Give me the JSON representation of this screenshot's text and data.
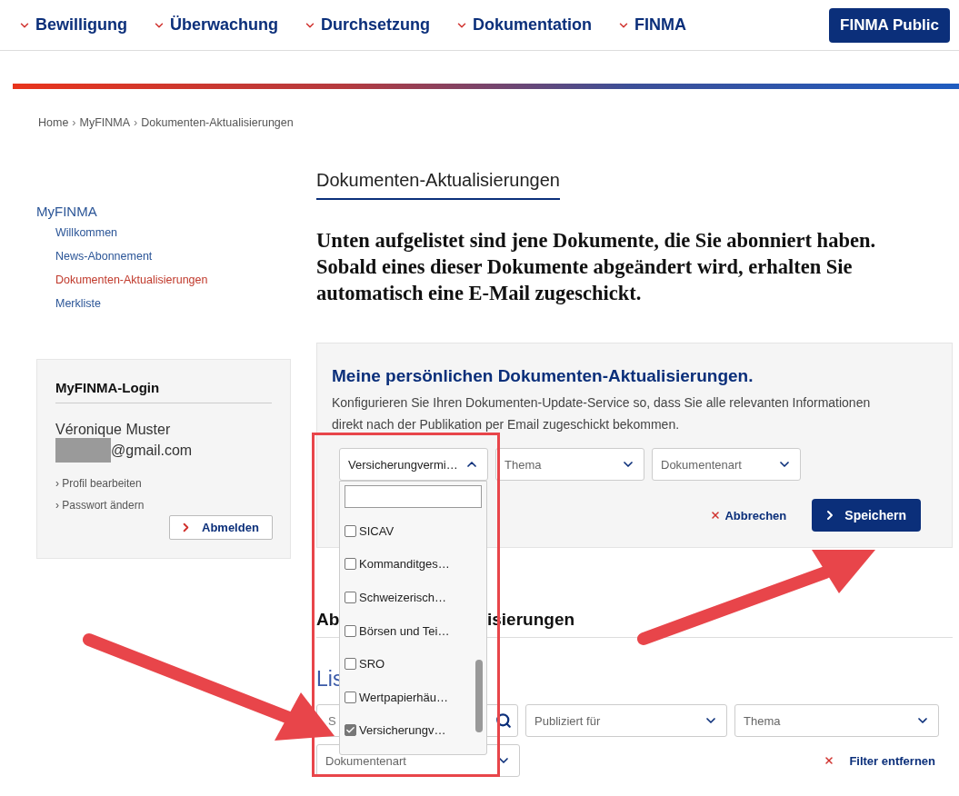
{
  "nav": {
    "items": [
      {
        "label": "Bewilligung"
      },
      {
        "label": "Überwachung"
      },
      {
        "label": "Durchsetzung"
      },
      {
        "label": "Dokumentation"
      },
      {
        "label": "FINMA"
      }
    ],
    "public_button": "FINMA Public"
  },
  "breadcrumb": {
    "separator": "›",
    "items": [
      "Home",
      "MyFINMA",
      "Dokumenten-Aktualisierungen"
    ]
  },
  "sidebar": {
    "title": "MyFINMA",
    "items": [
      {
        "label": "Willkommen",
        "selected": false
      },
      {
        "label": "News-Abonnement",
        "selected": false
      },
      {
        "label": "Dokumenten-Aktualisierungen",
        "selected": true
      },
      {
        "label": "Merkliste",
        "selected": false
      }
    ]
  },
  "login": {
    "title": "MyFINMA-Login",
    "name": "Véronique Muster",
    "email": "@gmail.com",
    "links": [
      "› Profil bearbeiten",
      "› Passwort ändern"
    ],
    "logout_button": "Abmelden"
  },
  "page_title": "Dokumenten-Aktualisierungen",
  "lead": "Unten aufgelistet sind jene Dokumente, die Sie abonniert haben. Sobald eines dieser Dokumente abgeändert wird, erhalten Sie automatisch eine E-Mail zugeschickt.",
  "subscription": {
    "title": "Meine persönlichen Dokumenten-Aktualisierungen.",
    "description": "Konfigurieren Sie Ihren Dokumenten-Update-Service so, dass Sie alle relevanten Informationen direkt nach der Publikation per Email zugeschickt bekommen.",
    "selects": [
      {
        "value": "Versicherungvermi…",
        "expanded": true
      },
      {
        "placeholder": "Thema",
        "expanded": false
      },
      {
        "placeholder": "Dokumentenart",
        "expanded": false
      }
    ],
    "dropdown": {
      "options": [
        {
          "label": "SICAV",
          "checked": false
        },
        {
          "label": "Kommanditges…",
          "checked": false
        },
        {
          "label": "Schweizerisch…",
          "checked": false
        },
        {
          "label": "Börsen und Tei…",
          "checked": false
        },
        {
          "label": "SRO",
          "checked": false
        },
        {
          "label": "Wertpapierhäu…",
          "checked": false
        },
        {
          "label": "Versicherungv…",
          "checked": true
        }
      ]
    },
    "cancel_button": "Abbrechen",
    "save_button": "Speichern"
  },
  "list_heading_parts": [
    "Ab",
    "isierungen"
  ],
  "list_title": "Lis",
  "filters": {
    "search_placeholder": "S",
    "selects": [
      {
        "placeholder": "Publiziert für"
      },
      {
        "placeholder": "Thema"
      },
      {
        "placeholder": "Dokumentenart"
      }
    ],
    "clear_button": "Filter entfernen"
  }
}
